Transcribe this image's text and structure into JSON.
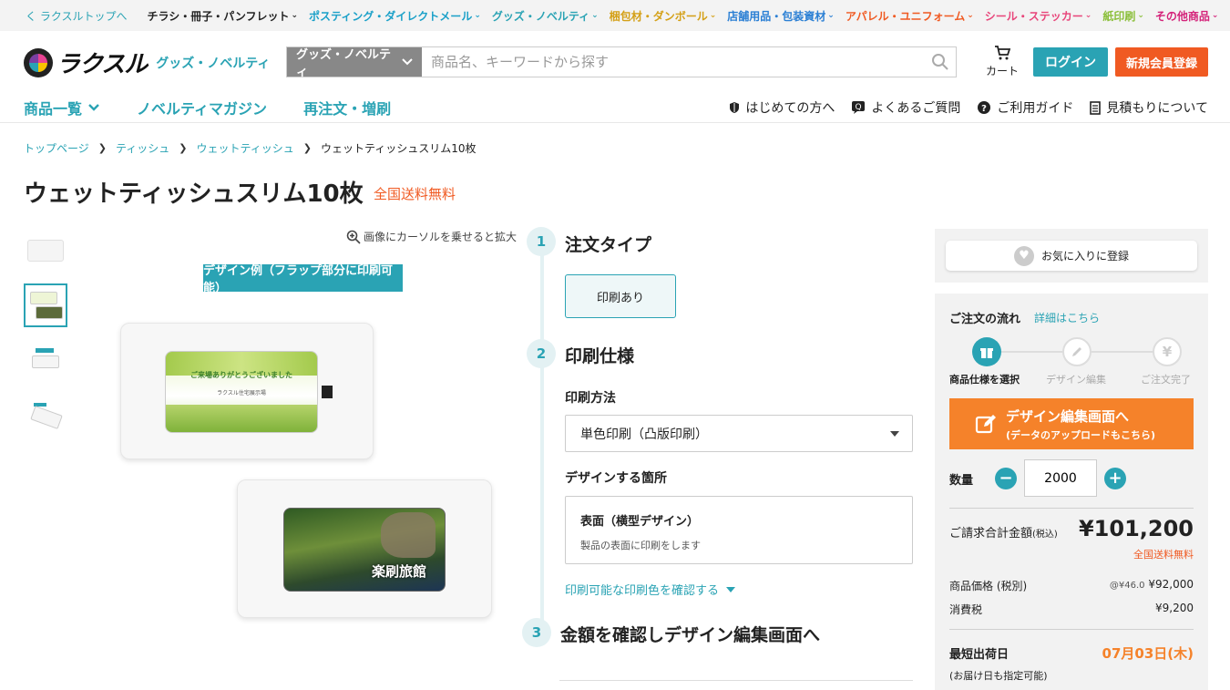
{
  "topbar": {
    "back": "く ラクスルトップへ",
    "categories": [
      {
        "label": "チラシ・冊子・パンフレット",
        "color": "#222222"
      },
      {
        "label": "ポスティング・ダイレクトメール",
        "color": "#1aa0c8"
      },
      {
        "label": "グッズ・ノベルティ",
        "color": "#2aa3b4"
      },
      {
        "label": "梱包材・ダンボール",
        "color": "#d4a017"
      },
      {
        "label": "店舗用品・包装資材",
        "color": "#2a7fd4"
      },
      {
        "label": "アパレル・ユニフォーム",
        "color": "#f05a22"
      },
      {
        "label": "シール・ステッカー",
        "color": "#e8457a"
      },
      {
        "label": "紙印刷",
        "color": "#8bbf3a"
      },
      {
        "label": "その他商品",
        "color": "#d4237a"
      }
    ]
  },
  "header": {
    "logo_text": "ラクスル",
    "logo_sub": "グッズ・ノベルティ",
    "search_category": "グッズ・ノベルティ",
    "search_placeholder": "商品名、キーワードから探す",
    "cart": "カート",
    "login": "ログイン",
    "signup": "新規会員登録"
  },
  "nav": {
    "items": [
      "商品一覧",
      "ノベルティマガジン",
      "再注文・増刷"
    ],
    "help": [
      "はじめての方へ",
      "よくあるご質問",
      "ご利用ガイド",
      "見積もりについて"
    ]
  },
  "breadcrumb": [
    "トップページ",
    "ティッシュ",
    "ウェットティッシュ",
    "ウェットティッシュスリム10枚"
  ],
  "product": {
    "title": "ウェットティッシュスリム10枚",
    "shipping_badge": "全国送料無料",
    "zoom_hint": "画像にカーソルを乗せると拡大",
    "design_badge": "デザイン例（フラップ部分に印刷可能）",
    "sample1_line1": "ご来場ありがとうございました",
    "sample1_line2": "ラクスル住宅展示場",
    "sample2_text": "楽刷旅館"
  },
  "steps": {
    "s1_num": "1",
    "s1_title": "注文タイプ",
    "s1_option": "印刷あり",
    "s2_num": "2",
    "s2_title": "印刷仕様",
    "method_label": "印刷方法",
    "method_value": "単色印刷（凸版印刷）",
    "place_label": "デザインする箇所",
    "place_title": "表面（横型デザイン）",
    "place_desc": "製品の表面に印刷をします",
    "color_link": "印刷可能な印刷色を確認する",
    "s3_num": "3",
    "s3_title": "金額を確認しデザイン編集画面へ"
  },
  "sidebar": {
    "favorite": "お気に入りに登録",
    "flow_title": "ご注文の流れ",
    "flow_link": "詳細はこちら",
    "flow_steps": [
      "商品仕様を選択",
      "デザイン編集",
      "ご注文完了"
    ],
    "design_btn_l1": "デザイン編集画面へ",
    "design_btn_l2": "(データのアップロードもこちら)",
    "qty_label": "数量",
    "qty_value": "2000",
    "total_label": "ご請求合計金額",
    "total_tax": "(税込)",
    "total_value": "¥101,200",
    "total_free": "全国送料無料",
    "price_label": "商品価格 (税別)",
    "unit_price": "@¥46.0",
    "price_value": "¥92,000",
    "tax_label": "消費税",
    "tax_value": "¥9,200",
    "ship_label": "最短出荷日",
    "ship_value": "07月03日(木)",
    "ship_note": "(お届け日も指定可能)"
  }
}
